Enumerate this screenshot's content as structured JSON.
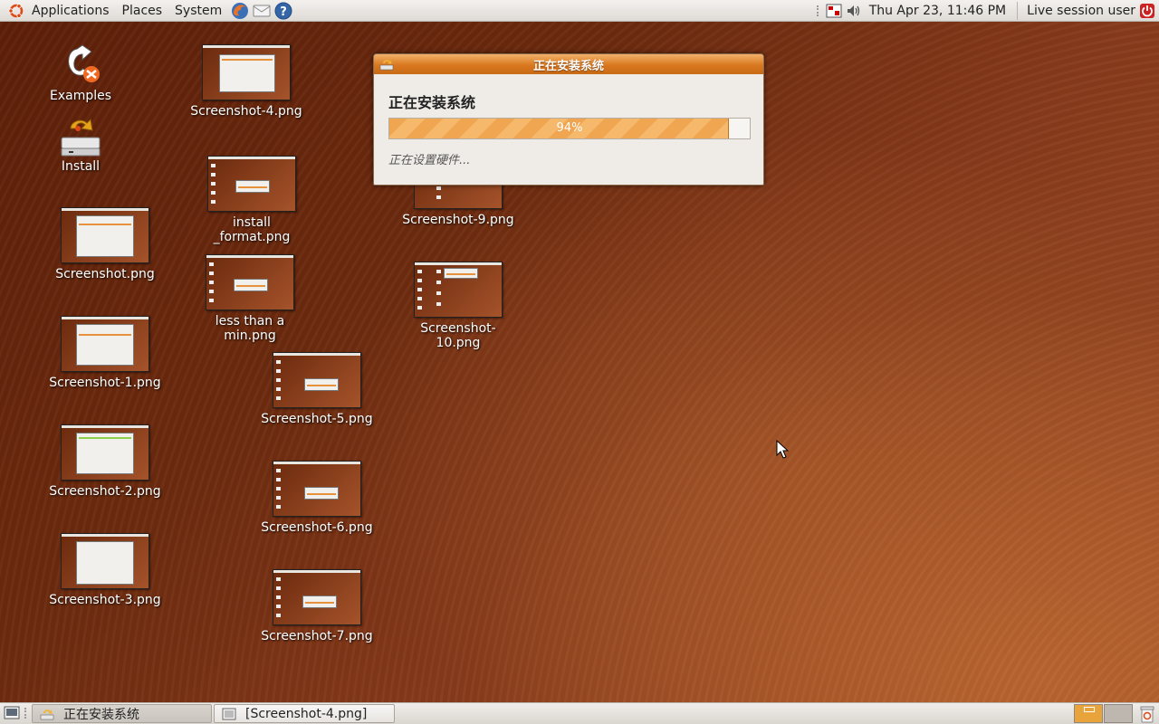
{
  "top_panel": {
    "menus": [
      "Applications",
      "Places",
      "System"
    ],
    "clock": "Thu Apr 23, 11:46 PM",
    "user": "Live session user"
  },
  "desktop": {
    "icons": [
      {
        "label": "Examples"
      },
      {
        "label": "Install"
      },
      {
        "label": "Screenshot.png"
      },
      {
        "label": "Screenshot-1.png"
      },
      {
        "label": "Screenshot-2.png"
      },
      {
        "label": "Screenshot-3.png"
      },
      {
        "label": "Screenshot-4.png"
      },
      {
        "label": "install _format.png"
      },
      {
        "label": "less than a min.png"
      },
      {
        "label": "Screenshot-5.png"
      },
      {
        "label": "Screenshot-6.png"
      },
      {
        "label": "Screenshot-7.png"
      },
      {
        "label": "Screenshot-9.png"
      },
      {
        "label": "Screenshot-10.png"
      }
    ]
  },
  "dialog": {
    "title": "正在安装系统",
    "heading": "正在安装系统",
    "progress_value": 94,
    "progress_text": "94%",
    "status": "正在设置硬件..."
  },
  "taskbar": {
    "tasks": [
      {
        "label": "正在安装系统",
        "active": true
      },
      {
        "label": "[Screenshot-4.png]",
        "active": false
      }
    ]
  },
  "colors": {
    "accent": "#e8913c",
    "titlebar": "#d9781f",
    "desktop": "#7a3212"
  }
}
